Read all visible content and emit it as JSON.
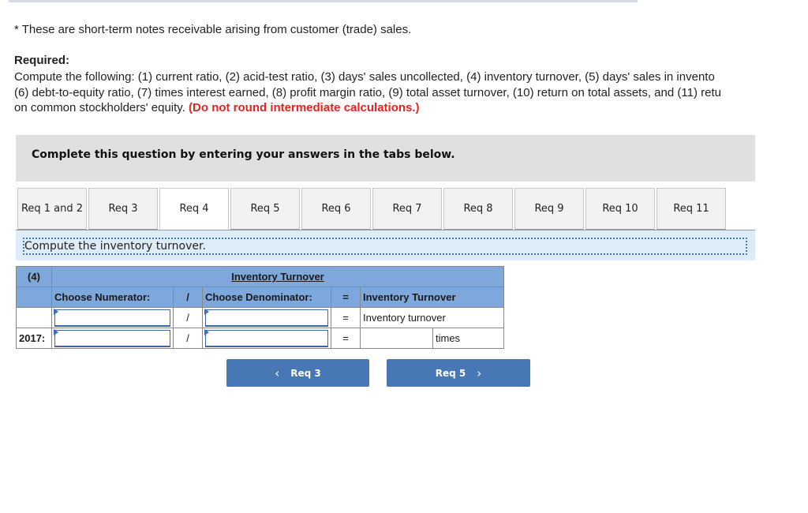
{
  "footnote": "* These are short-term notes receivable arising from customer (trade) sales.",
  "required": {
    "heading": "Required:",
    "lines": [
      "Compute the following: (1) current ratio, (2) acid-test ratio, (3) days' sales uncollected, (4) inventory turnover, (5) days' sales in invento",
      "(6) debt-to-equity ratio, (7) times interest earned, (8) profit margin ratio, (9) total asset turnover, (10) return on total assets, and (11) retu",
      "on common stockholders' equity. "
    ],
    "note": "(Do not round intermediate calculations.)"
  },
  "instruction": "Complete this question by entering your answers in the tabs below.",
  "tabs": [
    {
      "label": "Req 1 and 2",
      "active": false
    },
    {
      "label": "Req 3",
      "active": false
    },
    {
      "label": "Req 4",
      "active": true
    },
    {
      "label": "Req 5",
      "active": false
    },
    {
      "label": "Req 6",
      "active": false
    },
    {
      "label": "Req 7",
      "active": false
    },
    {
      "label": "Req 8",
      "active": false
    },
    {
      "label": "Req 9",
      "active": false
    },
    {
      "label": "Req 10",
      "active": false
    },
    {
      "label": "Req 11",
      "active": false
    }
  ],
  "prompt": "Compute the inventory turnover.",
  "table": {
    "number_label": "(4)",
    "title": "Inventory Turnover",
    "numerator_header": "Choose Numerator:",
    "divide_symbol": "/",
    "denominator_header": "Choose Denominator:",
    "equals_symbol": "=",
    "result_header": "Inventory Turnover",
    "row1": {
      "label": "",
      "numerator": "",
      "denominator": "",
      "result": "Inventory turnover"
    },
    "row2": {
      "label": "2017:",
      "numerator": "",
      "denominator": "",
      "result": "",
      "unit": "times"
    }
  },
  "nav": {
    "prev_label": "Req 3",
    "next_label": "Req 5",
    "prev_icon": "‹",
    "next_icon": "›"
  },
  "colors": {
    "header_blue": "#7ea7dc",
    "button_blue": "#4777b5",
    "note_red": "#e8221f"
  }
}
